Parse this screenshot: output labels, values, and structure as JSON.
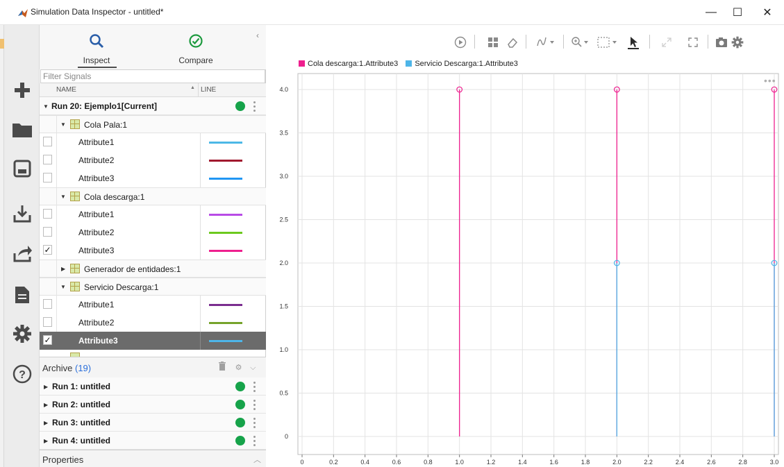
{
  "window": {
    "title": "Simulation Data Inspector - untitled*",
    "controls": {
      "minimize": "—",
      "maximize": "☐",
      "close": "✕"
    }
  },
  "left_toolbar": {
    "items": [
      {
        "icon": "plus-icon"
      },
      {
        "icon": "folder-icon"
      },
      {
        "icon": "save-icon"
      },
      {
        "icon": "import-icon"
      },
      {
        "icon": "export-icon"
      },
      {
        "icon": "report-icon"
      },
      {
        "icon": "gear-icon"
      },
      {
        "icon": "help-icon"
      }
    ]
  },
  "panel": {
    "tabs": [
      {
        "label": "Inspect",
        "icon": "magnifier-icon",
        "active": true
      },
      {
        "label": "Compare",
        "icon": "check-circle-icon",
        "active": false
      }
    ],
    "collapse_glyph": "‹",
    "filter_placeholder": "Filter Signals",
    "columns": {
      "name": "NAME",
      "line": "LINE",
      "sort": "▲"
    },
    "current_run": {
      "label": "Run 20: Ejemplo1[Current]",
      "status_color": "#16a34a"
    },
    "groups": [
      {
        "label": "Cola Pala:1",
        "expanded": true,
        "signals": [
          {
            "label": "Attribute1",
            "checked": false,
            "color": "#4cb8e6"
          },
          {
            "label": "Attribute2",
            "checked": false,
            "color": "#a1192e"
          },
          {
            "label": "Attribute3",
            "checked": false,
            "color": "#2196f3"
          }
        ]
      },
      {
        "label": "Cola descarga:1",
        "expanded": true,
        "signals": [
          {
            "label": "Attribute1",
            "checked": false,
            "color": "#b84ce6"
          },
          {
            "label": "Attribute2",
            "checked": false,
            "color": "#6cc91e"
          },
          {
            "label": "Attribute3",
            "checked": true,
            "color": "#ee1f8e"
          }
        ]
      },
      {
        "label": "Generador de entidades:1",
        "expanded": false,
        "signals": []
      },
      {
        "label": "Servicio Descarga:1",
        "expanded": true,
        "signals": [
          {
            "label": "Attribute1",
            "checked": false,
            "color": "#7b2d8f"
          },
          {
            "label": "Attribute2",
            "checked": false,
            "color": "#76a32b"
          },
          {
            "label": "Attribute3",
            "checked": true,
            "color": "#4db5e8",
            "selected": true
          }
        ]
      }
    ],
    "archive": {
      "title": "Archive",
      "count": "(19)",
      "runs": [
        {
          "label": "Run 1: untitled"
        },
        {
          "label": "Run 2: untitled"
        },
        {
          "label": "Run 3: untitled"
        },
        {
          "label": "Run 4: untitled"
        }
      ]
    },
    "properties_label": "Properties"
  },
  "plot_toolbar": {
    "buttons": [
      {
        "icon": "replay-icon"
      },
      {
        "icon": "layout-icon"
      },
      {
        "icon": "eraser-icon"
      },
      {
        "icon": "visualization-icon"
      },
      {
        "icon": "zoom-icon"
      },
      {
        "icon": "fit-icon"
      },
      {
        "icon": "cursor-icon"
      },
      {
        "icon": "expand-icon"
      },
      {
        "icon": "fullscreen-icon"
      },
      {
        "icon": "snapshot-icon"
      },
      {
        "icon": "settings-icon"
      }
    ]
  },
  "chart_data": {
    "type": "stem",
    "title": "",
    "xlabel": "",
    "ylabel": "",
    "xlim": [
      0,
      3.0
    ],
    "ylim": [
      0,
      4.0
    ],
    "x_ticks": [
      "0",
      "0.2",
      "0.4",
      "0.6",
      "0.8",
      "1.0",
      "1.2",
      "1.4",
      "1.6",
      "1.8",
      "2.0",
      "2.2",
      "2.4",
      "2.6",
      "2.8",
      "3.0"
    ],
    "y_ticks": [
      "0",
      "0.5",
      "1.0",
      "1.5",
      "2.0",
      "2.5",
      "3.0",
      "3.5",
      "4.0"
    ],
    "grid": true,
    "legend_position": "top-left",
    "series": [
      {
        "name": "Cola descarga:1.Attribute3",
        "color": "#ee1f8e",
        "x": [
          1.0,
          2.0,
          3.0
        ],
        "y": [
          4.0,
          4.0,
          4.0
        ]
      },
      {
        "name": "Servicio Descarga:1.Attribute3",
        "color": "#4db5e8",
        "x": [
          2.0,
          3.0
        ],
        "y": [
          2.0,
          2.0
        ]
      }
    ]
  }
}
